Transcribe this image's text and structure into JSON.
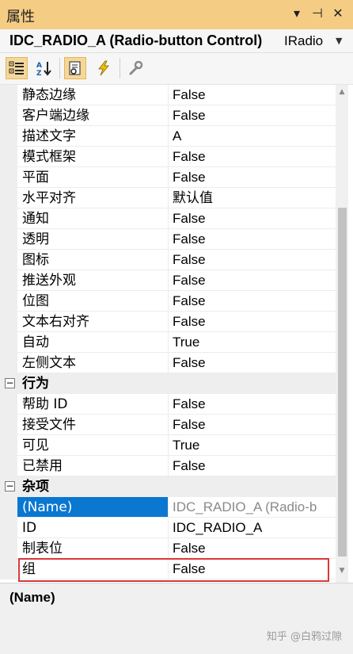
{
  "panel": {
    "title": "属性",
    "menu_icon": "▾",
    "pin_icon": "⊣",
    "close_icon": "✕"
  },
  "object_bar": {
    "name": "IDC_RADIO_A (Radio-button Control)",
    "type": "IRadio",
    "dropdown_icon": "▼"
  },
  "toolbar": {
    "buttons": [
      {
        "name": "categorized",
        "icon": "categorized-icon",
        "active": true
      },
      {
        "name": "alphabetical",
        "icon": "sort-az-icon",
        "active": false
      },
      {
        "name": "properties",
        "icon": "properties-icon",
        "active": true
      },
      {
        "name": "events",
        "icon": "lightning-icon",
        "active": false
      },
      {
        "name": "overrides",
        "icon": "wrench-icon",
        "active": false
      }
    ]
  },
  "rows": [
    {
      "name": "静态边缘",
      "value": "False"
    },
    {
      "name": "客户端边缘",
      "value": "False"
    },
    {
      "name": "描述文字",
      "value": "A"
    },
    {
      "name": "模式框架",
      "value": "False"
    },
    {
      "name": "平面",
      "value": "False"
    },
    {
      "name": "水平对齐",
      "value": "默认值"
    },
    {
      "name": "通知",
      "value": "False"
    },
    {
      "name": "透明",
      "value": "False"
    },
    {
      "name": "图标",
      "value": "False"
    },
    {
      "name": "推送外观",
      "value": "False"
    },
    {
      "name": "位图",
      "value": "False"
    },
    {
      "name": "文本右对齐",
      "value": "False"
    },
    {
      "name": "自动",
      "value": "True"
    },
    {
      "name": "左侧文本",
      "value": "False"
    },
    {
      "category": "行为",
      "expander": "−"
    },
    {
      "name": "帮助 ID",
      "value": "False"
    },
    {
      "name": "接受文件",
      "value": "False"
    },
    {
      "name": "可见",
      "value": "True"
    },
    {
      "name": "已禁用",
      "value": "False"
    },
    {
      "category": "杂项",
      "expander": "−"
    },
    {
      "name": "(Name)",
      "value": "IDC_RADIO_A (Radio-b",
      "selected": true
    },
    {
      "name": "ID",
      "value": "IDC_RADIO_A"
    },
    {
      "name": "制表位",
      "value": "False"
    },
    {
      "name": "组",
      "value": "False"
    }
  ],
  "scrollbar": {
    "up": "▲",
    "down": "▼"
  },
  "description": {
    "title": "(Name)"
  },
  "watermark": "知乎 @白鸦过隙",
  "colors": {
    "title_bar": "#f5cc84",
    "selection": "#0a77d1",
    "highlight_box": "#d9383a"
  }
}
